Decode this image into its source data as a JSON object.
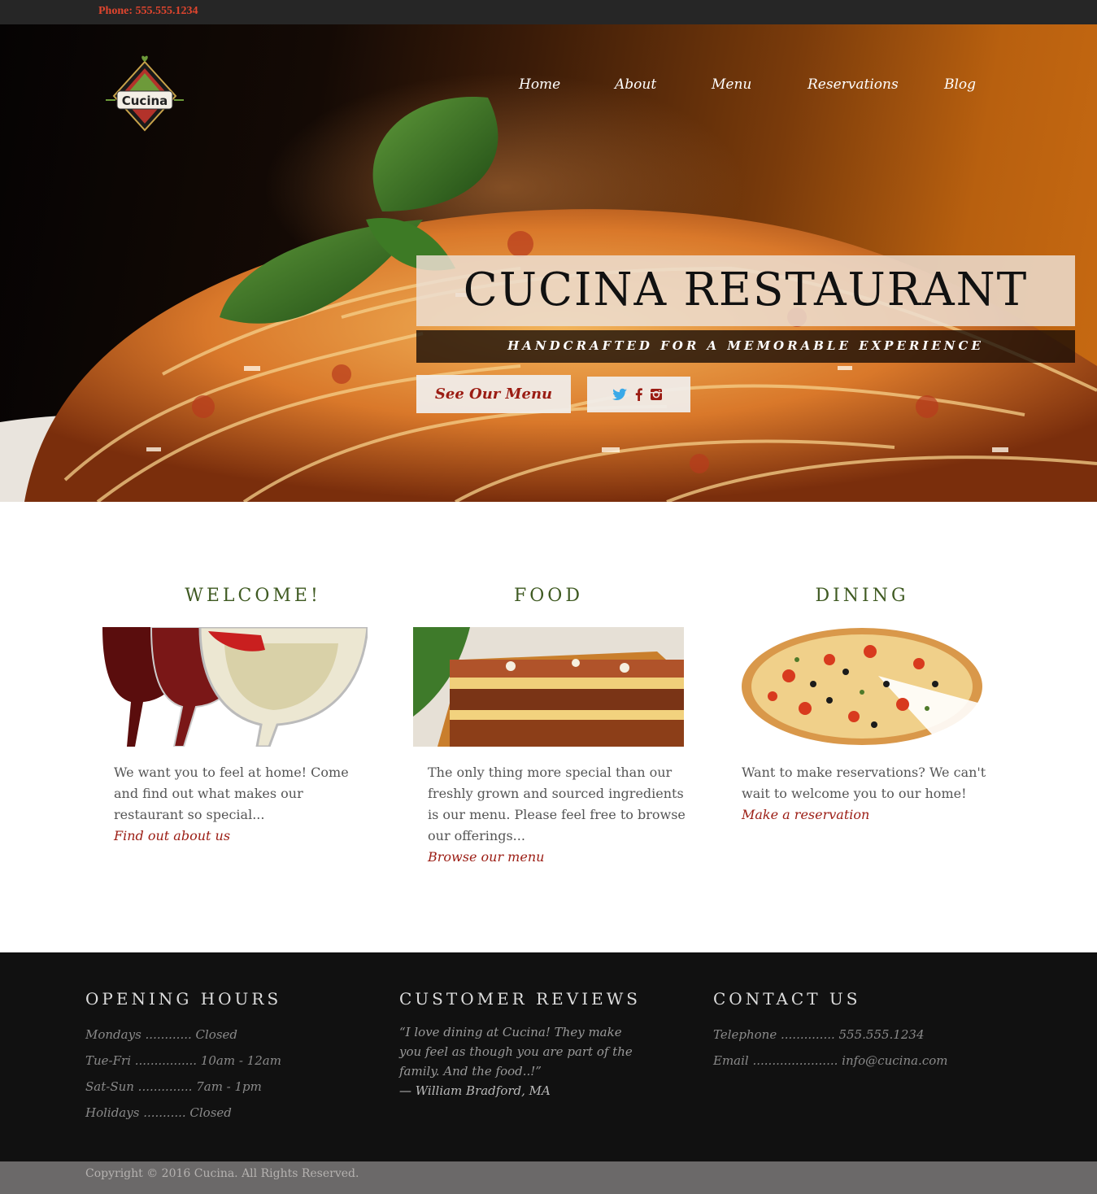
{
  "topbar": {
    "phone": "Phone: 555.555.1234"
  },
  "brand": {
    "logo_text": "Cucina"
  },
  "nav": [
    "Home",
    "About",
    "Menu",
    "Reservations",
    "Blog"
  ],
  "hero": {
    "title": "CUCINA RESTAURANT",
    "subtitle": "HANDCRAFTED FOR A MEMORABLE EXPERIENCE",
    "cta": "See Our Menu",
    "social": [
      "twitter-icon",
      "facebook-icon",
      "instagram-icon"
    ]
  },
  "features": [
    {
      "title": "WELCOME!",
      "text": "We want you to feel at home! Come and find out what makes our restaurant so special...",
      "link": "Find out about us",
      "image": "wine-glasses"
    },
    {
      "title": "FOOD",
      "text": "The only thing more special than our freshly grown and sourced ingredients is our menu. Please feel free to browse our offerings...",
      "link": "Browse our menu",
      "image": "lasagna"
    },
    {
      "title": "DINING",
      "text": "Want to make reservations? We can't wait to welcome you to our home!",
      "link": "Make a reservation",
      "image": "pizza"
    }
  ],
  "footer": {
    "hours": {
      "title": "OPENING HOURS",
      "lines": [
        "Mondays ............ Closed",
        "Tue-Fri ................ 10am - 12am",
        "Sat-Sun .............. 7am - 1pm",
        "Holidays ........... Closed"
      ]
    },
    "reviews": {
      "title": "CUSTOMER REVIEWS",
      "quote": "“I love dining at Cucina! They make you feel as though you are part of the family. And the food..!”",
      "author": "— William Bradford, MA"
    },
    "contact": {
      "title": "CONTACT US",
      "lines": [
        "Telephone .............. 555.555.1234",
        "Email ...................... info@cucina.com"
      ]
    }
  },
  "copyright": "Copyright © 2016 Cucina. All Rights Reserved.",
  "colors": {
    "accent_red": "#9b1c13",
    "green": "#3f5a22",
    "footer_bg": "#111111",
    "phone_red": "#e0452e"
  }
}
